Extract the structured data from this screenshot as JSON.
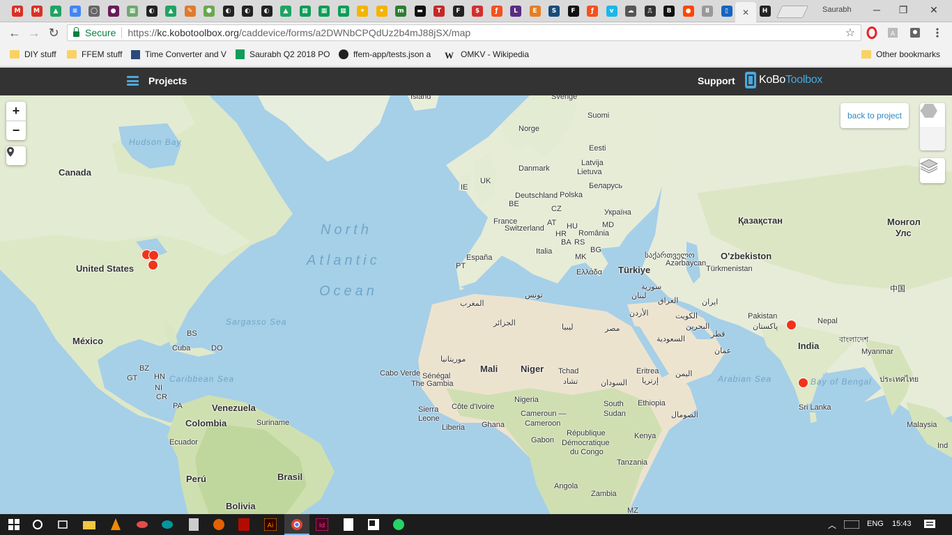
{
  "browser": {
    "tabs": [
      {
        "icon": "gmail-icon",
        "color": "#d93025",
        "glyph": "M"
      },
      {
        "icon": "gmail-icon",
        "color": "#d93025",
        "glyph": "M"
      },
      {
        "icon": "google-drive-icon",
        "color": "#1fa463",
        "glyph": "▲"
      },
      {
        "icon": "google-docs-icon",
        "color": "#4285f4",
        "glyph": "≡"
      },
      {
        "icon": "circle-icon",
        "color": "#666666",
        "glyph": "◯"
      },
      {
        "icon": "dark-circle-icon",
        "color": "#6b1b5a",
        "glyph": "●"
      },
      {
        "icon": "grid-icon",
        "color": "#6fa86f",
        "glyph": "▦"
      },
      {
        "icon": "github-icon",
        "color": "#222222",
        "glyph": "◐"
      },
      {
        "icon": "google-drive-icon",
        "color": "#1fa463",
        "glyph": "▲"
      },
      {
        "icon": "feather-icon",
        "color": "#e07a2e",
        "glyph": "✎"
      },
      {
        "icon": "hexagon-icon",
        "color": "#6aa84f",
        "glyph": "⬢"
      },
      {
        "icon": "github-icon",
        "color": "#222222",
        "glyph": "◐"
      },
      {
        "icon": "github-icon",
        "color": "#222222",
        "glyph": "◐"
      },
      {
        "icon": "github-icon",
        "color": "#222222",
        "glyph": "◐"
      },
      {
        "icon": "google-drive-icon",
        "color": "#1fa463",
        "glyph": "▲"
      },
      {
        "icon": "google-sheets-icon",
        "color": "#0f9d58",
        "glyph": "▦"
      },
      {
        "icon": "google-sheets-icon",
        "color": "#0f9d58",
        "glyph": "▦"
      },
      {
        "icon": "google-sheets-icon",
        "color": "#0f9d58",
        "glyph": "▦"
      },
      {
        "icon": "lightbulb-icon",
        "color": "#f4b400",
        "glyph": "✦"
      },
      {
        "icon": "lightbulb-icon",
        "color": "#f4b400",
        "glyph": "✦"
      },
      {
        "icon": "m-icon",
        "color": "#2e7d32",
        "glyph": "m"
      },
      {
        "icon": "tv-icon",
        "color": "#111111",
        "glyph": "▬"
      },
      {
        "icon": "t-icon",
        "color": "#c62828",
        "glyph": "T"
      },
      {
        "icon": "f-icon",
        "color": "#222222",
        "glyph": "F"
      },
      {
        "icon": "s-circle-icon",
        "color": "#d32f2f",
        "glyph": "$"
      },
      {
        "icon": "s-square-icon",
        "color": "#f4511e",
        "glyph": "ƒ"
      },
      {
        "icon": "lsu-icon",
        "color": "#5b2c83",
        "glyph": "L"
      },
      {
        "icon": "e-icon",
        "color": "#e67e22",
        "glyph": "E"
      },
      {
        "icon": "scroll-icon",
        "color": "#1a4b7a",
        "glyph": "S"
      },
      {
        "icon": "f-bold-icon",
        "color": "#111111",
        "glyph": "F"
      },
      {
        "icon": "s-square-icon",
        "color": "#f4511e",
        "glyph": "ƒ"
      },
      {
        "icon": "vimeo-icon",
        "color": "#1ab7ea",
        "glyph": "v"
      },
      {
        "icon": "cloud-icon",
        "color": "#555555",
        "glyph": "☁"
      },
      {
        "icon": "pulse-icon",
        "color": "#333333",
        "glyph": "⎍"
      },
      {
        "icon": "bbc-icon",
        "color": "#111111",
        "glyph": "B"
      },
      {
        "icon": "reddit-icon",
        "color": "#ff4500",
        "glyph": "●"
      },
      {
        "icon": "pause-icon",
        "color": "#999999",
        "glyph": "Ⅱ"
      },
      {
        "icon": "tablet-icon",
        "color": "#1565c0",
        "glyph": "▯"
      },
      {
        "icon": "close-icon",
        "color": "#555555",
        "glyph": "✕"
      },
      {
        "icon": "htg-icon",
        "color": "#222222",
        "glyph": "H"
      }
    ],
    "profile_name": "Saurabh",
    "secure_label": "Secure",
    "url_prefix": "https://",
    "url_host": "kc.kobotoolbox.org",
    "url_path": "/caddevice/forms/a2DWNbCPQdUz2b4mJ88jSX/map",
    "bookmarks": [
      {
        "label": "DIY stuff",
        "icon": "folder-icon"
      },
      {
        "label": "FFEM stuff",
        "icon": "folder-icon"
      },
      {
        "label": "Time Converter and V",
        "icon": "clock-icon"
      },
      {
        "label": "Saurabh Q2 2018 PO",
        "icon": "sheets-icon"
      },
      {
        "label": "ffem-app/tests.json a",
        "icon": "github-icon"
      },
      {
        "label": "OMKV - Wikipedia",
        "icon": "wikipedia-icon"
      }
    ],
    "other_bookmarks": "Other bookmarks"
  },
  "app": {
    "projects_label": "Projects",
    "support_label": "Support",
    "logo_kobo": "KoBo",
    "logo_toolbox": "Toolbox",
    "accent_color": "#4aa8dc"
  },
  "map": {
    "zoom_in": "+",
    "zoom_out": "−",
    "back_to_project": "back to project",
    "submission_color": "#f0341a",
    "labels": {
      "ocean_north": "North",
      "ocean_atlantic": "Atlantic",
      "ocean_ocean": "Ocean",
      "hudson_bay": "Hudson Bay",
      "sargasso_sea": "Sargasso Sea",
      "caribbean_sea": "Caribbean Sea",
      "arabian_sea": "Arabian Sea",
      "bay_of_bengal": "Bay of Bengal",
      "island": "Ísland",
      "sverige": "Sverige",
      "suomi": "Suomi",
      "norge": "Norge",
      "eesti": "Eesti",
      "latvija": "Latvija",
      "lietuva": "Lietuva",
      "danmark": "Danmark",
      "belarus": "Беларусь",
      "uk": "UK",
      "ie": "IE",
      "deutschland": "Deutschland",
      "polska": "Polska",
      "be": "BE",
      "cz": "CZ",
      "ukraina": "Україна",
      "france": "France",
      "switzerland": "Switzerland",
      "at": "AT",
      "hu": "HU",
      "md": "MD",
      "hr": "HR",
      "romania": "România",
      "ba": "BA",
      "rs": "RS",
      "bg": "BG",
      "italia": "Italia",
      "mk": "MK",
      "espana": "España",
      "pt": "PT",
      "ellada": "Ελλάδα",
      "turkiye": "Türkiye",
      "georgia": "საქართველო",
      "azerbaycan": "Azərbaycan",
      "kazakhstan": "Қазақстан",
      "mongol": "Монгол",
      "uls": "Улс",
      "uzbekiston": "O'zbekiston",
      "turkmenistan": "Türkmenistan",
      "china": "中国",
      "suriya": "سورية",
      "lubnan": "لبنان",
      "iraq": "العراق",
      "iran": "ایران",
      "urdun": "الأردن",
      "kuwait": "الكويت",
      "bahrain": "البحرين",
      "qatar": "قطر",
      "saudi": "السعودية",
      "oman": "عمان",
      "yemen": "اليمن",
      "tunis": "تونس",
      "maghrib": "المغرب",
      "jazair": "الجزائر",
      "libya": "ليبيا",
      "misr": "مصر",
      "pakistan": "Pakistan",
      "pakistan_ur": "پاکستان",
      "nepal": "Nepal",
      "india": "India",
      "bangladesh": "বাংলাদেশ",
      "myanmar": "Myanmar",
      "thailand": "ประเทศไทย",
      "srilanka": "Sri Lanka",
      "malaysia": "Malaysia",
      "ind": "Ind",
      "muritania": "موريتانيا",
      "mali": "Mali",
      "niger": "Niger",
      "tchad": "Tchad",
      "tchad_ar": "تشاد",
      "sudan": "السودان",
      "eritrea": "Eritrea",
      "eritrea_ar": "إرتريا",
      "cabo_verde": "Cabo Verde",
      "senegal": "Sénégal",
      "gambia": "The Gambia",
      "sierra": "Sierra",
      "leone": "Leone",
      "liberia": "Liberia",
      "cote_divoire": "Côte d'Ivoire",
      "ghana": "Ghana",
      "nigeria": "Nigeria",
      "cameroun1": "Cameroun —",
      "cameroun2": "Cameroon",
      "south": "South",
      "sudan_en": "Sudan",
      "ethiopia": "Ethiopia",
      "somalia": "الصومال",
      "gabon": "Gabon",
      "rdc1": "République",
      "rdc2": "Démocratique",
      "rdc3": "du Congo",
      "kenya": "Kenya",
      "tanzania": "Tanzania",
      "angola": "Angola",
      "zambia": "Zambia",
      "mz": "MZ",
      "canada": "Canada",
      "united_states": "United States",
      "mexico": "México",
      "bs": "BS",
      "cuba": "Cuba",
      "do": "DO",
      "bz": "BZ",
      "gt": "GT",
      "hn": "HN",
      "ni": "NI",
      "cr": "CR",
      "pa": "PA",
      "venezuela": "Venezuela",
      "colombia": "Colombia",
      "suriname": "Suriname",
      "ecuador": "Ecuador",
      "peru": "Perú",
      "brasil": "Brasil",
      "bolivia": "Bolivia"
    }
  },
  "taskbar": {
    "language": "ENG",
    "time": "15:43"
  }
}
